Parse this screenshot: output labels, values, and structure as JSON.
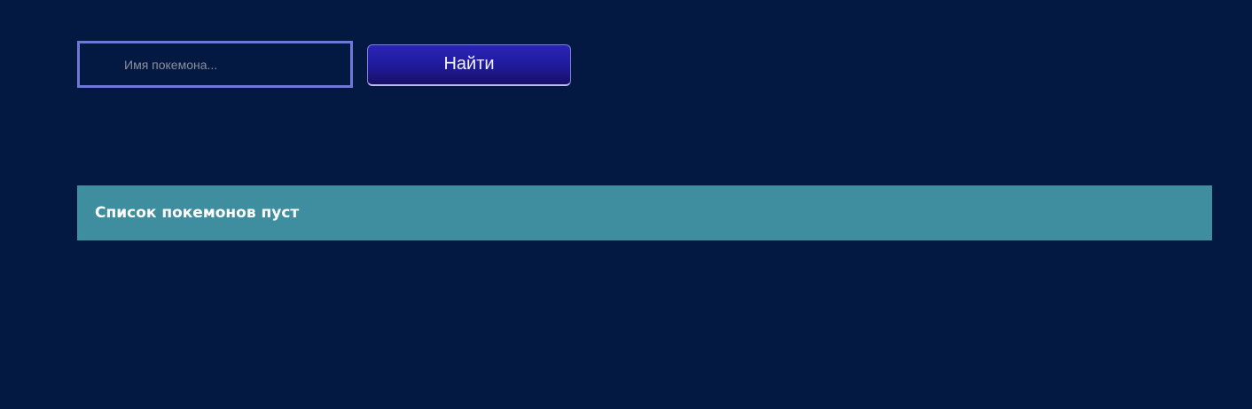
{
  "search": {
    "placeholder": "Имя покемона...",
    "value": "",
    "button_label": "Найти"
  },
  "results": {
    "empty_message": "Список покемонов пуст"
  },
  "colors": {
    "background": "#041941",
    "input_border": "#6f78d6",
    "button_gradient_top": "#2a24b8",
    "button_gradient_bottom": "#1a0f66",
    "banner": "#3e8ea0"
  }
}
